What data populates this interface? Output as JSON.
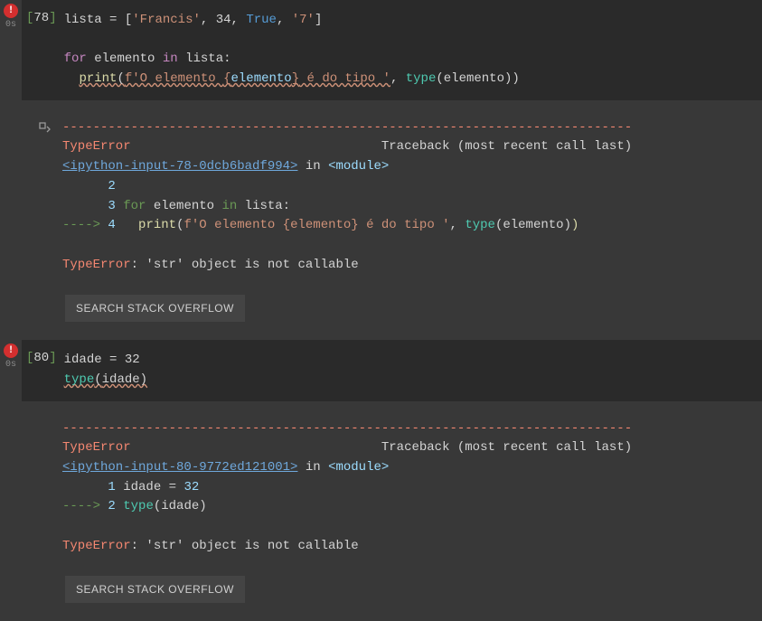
{
  "cells": [
    {
      "exec_label_open": "[",
      "exec_num": "78",
      "exec_label_close": "]",
      "exec_time": "0s",
      "code": {
        "line1_var": "lista",
        "line1_eq": " = ",
        "line1_b1": "[",
        "line1_s1": "'Francis'",
        "line1_c1": ", ",
        "line1_n1": "34",
        "line1_c2": ", ",
        "line1_bool": "True",
        "line1_c3": ", ",
        "line1_s2": "'7'",
        "line1_b2": "]",
        "blank": "",
        "line2_for": "for",
        "line2_sp1": " ",
        "line2_el": "elemento",
        "line2_sp2": " ",
        "line2_in": "in",
        "line2_sp3": " ",
        "line2_ls": "lista",
        "line2_col": ":",
        "line3_ind": "  ",
        "line3_print": "print",
        "line3_p1": "(",
        "line3_f": "f'O elemento ",
        "line3_fe_o": "{",
        "line3_feid": "elemento",
        "line3_fe_c": "}",
        "line3_f2": " é do tipo '",
        "line3_c": ", ",
        "line3_type": "type",
        "line3_p2": "(",
        "line3_el": "elemento",
        "line3_p3": ")",
        "line3_p4": ")"
      },
      "tb": {
        "dash": "---------------------------------------------------------------------------",
        "err": "TypeError",
        "trace_label": "                                 Traceback (most recent call last)",
        "link": "<ipython-input-78-0dcb6badf994>",
        "in": " in ",
        "mod": "<module>",
        "l2": "      2 ",
        "l3n": "      3 ",
        "l3_for": "for",
        "l3_sp": " elemento ",
        "l3_in": "in",
        "l3_rest": " lista:",
        "l4arrow": "----> ",
        "l4n": "4",
        "l4_sp": "   ",
        "l4_print": "print",
        "l4_p1": "(",
        "l4_fstr": "f'O elemento {elemento} é do tipo '",
        "l4_c": ", ",
        "l4_type": "type",
        "l4_p2": "(elemento)",
        "l4_p3": ")",
        "errfinal": "TypeError",
        "errmsg": ": 'str' object is not callable"
      },
      "button": "SEARCH STACK OVERFLOW"
    },
    {
      "exec_label_open": "[",
      "exec_num": "80",
      "exec_label_close": "]",
      "exec_time": "0s",
      "code": {
        "line1_var": "idade",
        "line1_eq": " = ",
        "line1_n": "32",
        "line2_type": "type",
        "line2_p1": "(",
        "line2_id": "idade",
        "line2_p2": ")"
      },
      "tb": {
        "dash": "---------------------------------------------------------------------------",
        "err": "TypeError",
        "trace_label": "                                 Traceback (most recent call last)",
        "link": "<ipython-input-80-9772ed121001>",
        "in": " in ",
        "mod": "<module>",
        "l1n": "      1 ",
        "l1_rest": "idade = ",
        "l1_num": "32",
        "l2arrow": "----> ",
        "l2n": "2",
        "l2_sp": " ",
        "l2_type": "type",
        "l2_p": "(idade)",
        "errfinal": "TypeError",
        "errmsg": ": 'str' object is not callable"
      },
      "button": "SEARCH STACK OVERFLOW"
    }
  ]
}
